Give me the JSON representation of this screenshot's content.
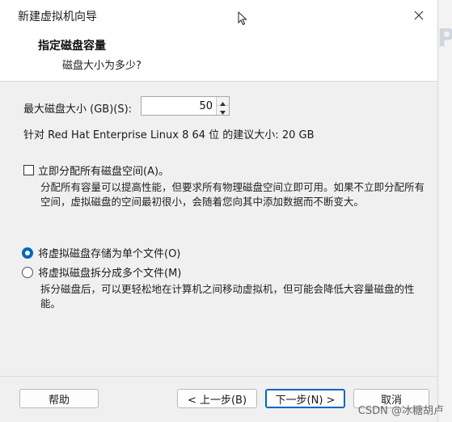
{
  "window": {
    "title": "新建虚拟机向导"
  },
  "header": {
    "title": "指定磁盘容量",
    "subtitle": "磁盘大小为多少?"
  },
  "disk_size": {
    "label": "最大磁盘大小 (GB)(S):",
    "value": "50",
    "recommendation": "针对 Red Hat Enterprise Linux 8 64 位 的建议大小: 20 GB"
  },
  "allocate": {
    "checkbox_label": "立即分配所有磁盘空间(A)。",
    "checked": false,
    "description": "分配所有容量可以提高性能，但要求所有物理磁盘空间立即可用。如果不立即分配所有空间，虚拟磁盘的空间最初很小，会随着您向其中添加数据而不断变大。"
  },
  "storage_options": {
    "single_file_label": "将虚拟磁盘存储为单个文件(O)",
    "multi_file_label": "将虚拟磁盘拆分成多个文件(M)",
    "selected": "single",
    "multi_description": "拆分磁盘后，可以更轻松地在计算机之间移动虚拟机，但可能会降低大容量磁盘的性能。"
  },
  "buttons": {
    "help": "帮助",
    "back": "< 上一步(B)",
    "next": "下一步(N) >",
    "cancel": "取消"
  },
  "watermark": "CSDN @冰糖胡卢",
  "colors": {
    "accent": "#0067c0",
    "content_bg": "#f0f0f0"
  },
  "icons": {
    "close": "close-icon",
    "spin_up": "chevron-up-icon",
    "spin_down": "chevron-down-icon",
    "cursor": "mouse-cursor-icon"
  }
}
